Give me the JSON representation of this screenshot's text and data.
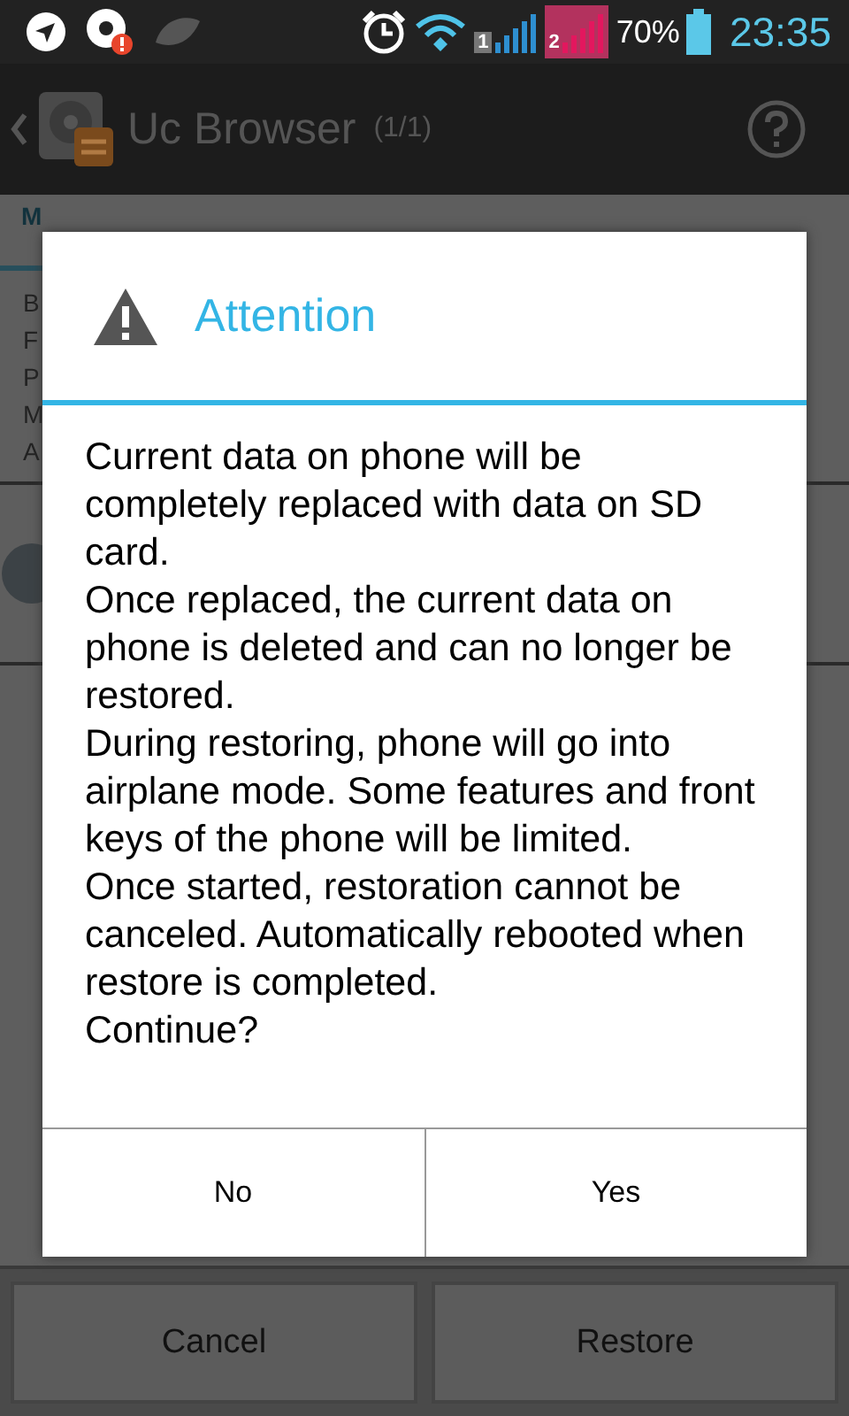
{
  "status_bar": {
    "battery": "70%",
    "time": "23:35",
    "sim_1": "1",
    "sim_2": "2"
  },
  "title_bar": {
    "title": "Uc Browser",
    "count": "(1/1)"
  },
  "section": {
    "header": "M",
    "rows": [
      "B",
      "F",
      "P",
      "M",
      "A"
    ]
  },
  "dialog": {
    "title": "Attention",
    "paragraphs": [
      "Current data on phone will be completely replaced with data on SD card.",
      "Once replaced, the current data on phone is deleted and can no longer be restored.",
      "During restoring, phone will go into airplane mode. Some features and front keys of the phone will be limited.",
      "Once started, restoration cannot be canceled. Automatically rebooted when restore is completed.",
      "Continue?"
    ],
    "buttons": [
      {
        "label": "No"
      },
      {
        "label": "Yes"
      }
    ]
  },
  "bottom_buttons": [
    {
      "label": "Cancel"
    },
    {
      "label": "Restore"
    }
  ]
}
